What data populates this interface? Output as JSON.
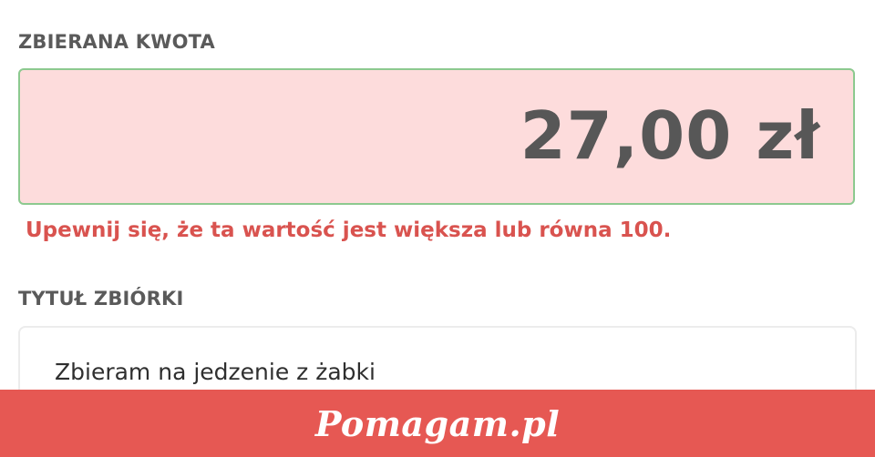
{
  "amount_field": {
    "label": "ZBIERANA KWOTA",
    "value": "27,00 zł",
    "error": "Upewnij się, że ta wartość jest większa lub równa 100."
  },
  "title_field": {
    "label": "TYTUŁ ZBIÓRKI",
    "value": "Zbieram na jedzenie z żabki"
  },
  "brand": {
    "logo_text": "Pomagam.pl"
  },
  "colors": {
    "error_text": "#d9534f",
    "invalid_field_bg": "#fddcdc",
    "field_border_green": "#8cc98f",
    "brand_bar": "#e65853"
  }
}
